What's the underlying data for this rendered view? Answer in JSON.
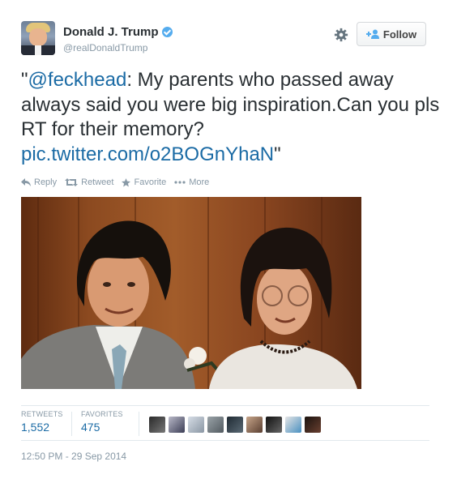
{
  "author": {
    "display_name": "Donald J. Trump",
    "screen_name": "@realDonaldTrump"
  },
  "follow_button": {
    "label": "Follow"
  },
  "tweet": {
    "open_quote": "\"",
    "mention": "@feckhead",
    "body": ":  My parents who passed away always said you were big inspiration.Can you pls RT for their memory? ",
    "link": "pic.twitter.com/o2BOGnYhaN",
    "close_quote": "\""
  },
  "actions": {
    "reply": "Reply",
    "retweet": "Retweet",
    "favorite": "Favorite",
    "more": "More"
  },
  "stats": {
    "retweets_label": "RETWEETS",
    "retweets_count": "1,552",
    "favorites_label": "FAVORITES",
    "favorites_count": "475"
  },
  "timestamp": "12:50 PM - 29 Sep 2014",
  "colors": {
    "link": "#1b6ba5",
    "verified": "#55acee",
    "muted": "#8899a6"
  }
}
